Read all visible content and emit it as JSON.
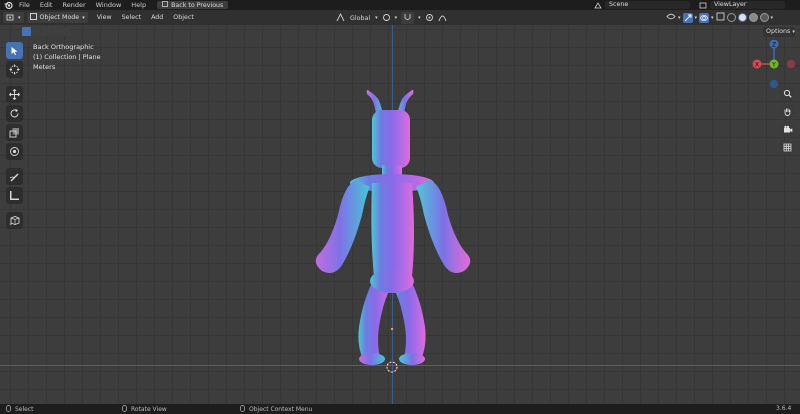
{
  "topbar": {
    "menus": [
      "File",
      "Edit",
      "Render",
      "Window",
      "Help"
    ],
    "back_label": "Back to Previous",
    "scene_label": "Scene",
    "view_layer_label": "ViewLayer"
  },
  "viewport_header": {
    "mode_label": "Object Mode",
    "menus": [
      "View",
      "Select",
      "Add",
      "Object"
    ],
    "orientation_label": "Global",
    "options_label": "Options"
  },
  "viewport": {
    "view_name": "Back Orthographic",
    "collection_info": "(1) Collection | Plane",
    "units": "Meters",
    "gizmo_axes": {
      "x_label": "X",
      "y_label": "Y",
      "z_label": "Z"
    },
    "colors": {
      "x_axis": "#a8474f",
      "z_axis": "#3a6fb6",
      "accent": "#4772b3"
    }
  },
  "toolbar": {
    "tools": [
      "select-box-icon",
      "cursor-icon",
      "move-icon",
      "rotate-icon",
      "scale-icon",
      "transform-icon",
      "annotate-icon",
      "measure-icon",
      "add-cube-icon"
    ]
  },
  "statusbar": {
    "select_label": "Select",
    "rotate_label": "Rotate View",
    "context_label": "Object Context Menu",
    "version": "3.6.4"
  }
}
